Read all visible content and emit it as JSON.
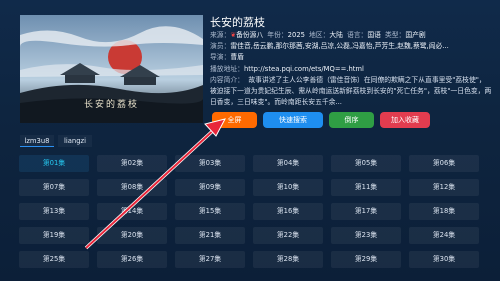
{
  "detail": {
    "title": "长安的荔枝",
    "poster_caption": "长安的荔枝",
    "meta": {
      "director_label": "来源：",
      "director_value": "备份源八",
      "year_label": "年份：",
      "year_value": "2025",
      "area_label": "地区：",
      "area_value": "大陆",
      "language_label": "语言：",
      "language_value": "国语",
      "type_label": "类型：",
      "type_value": "国产剧"
    },
    "cast_label": "演员：",
    "cast_value": "雷佳音,岳云鹏,那尔那茜,安湖,吕凉,公磊,冯嘉怡,芦芳生,赵魏,蔡鹭,阎必...",
    "director2_label": "导演：",
    "director2_value": "曹盾",
    "url_label": "播放地址：",
    "url_value": "http://stea.pqi.com/ets/MQ==.html",
    "intro_label": "内容简介：",
    "intro_value": "故事讲述了主人公李善德（雷佳音饰）在同僚的欺瞒之下从直事里受\"荔枝使\"，被迫接下一道为贵妃纪生辰、需从岭南运送新鲜荔枝到长安的\"死亡任务\"，荔枝\"一日色变，两日香变，三日味变\"。而岭南距长安五千余..."
  },
  "buttons": {
    "fullscreen": "全屏",
    "quick_search": "快速搜索",
    "sort": "倒序",
    "favorite": "加入收藏"
  },
  "sources": {
    "active": "lzm3u8",
    "other": "liangzi"
  },
  "episodes": [
    "第01集",
    "第02集",
    "第03集",
    "第04集",
    "第05集",
    "第06集",
    "第07集",
    "第08集",
    "第09集",
    "第10集",
    "第11集",
    "第12集",
    "第13集",
    "第14集",
    "第15集",
    "第16集",
    "第17集",
    "第18集",
    "第19集",
    "第20集",
    "第21集",
    "第22集",
    "第23集",
    "第24集",
    "第25集",
    "第26集",
    "第27集",
    "第28集",
    "第29集",
    "第30集"
  ],
  "current_episode_index": 0,
  "colors": {
    "fullscreen": "#ff6a00",
    "quick_search": "#1e8ef0",
    "sort": "#2f9e44",
    "favorite": "#e23c4f",
    "current_episode": "#26c8f0",
    "arrow": "#e8263a"
  }
}
